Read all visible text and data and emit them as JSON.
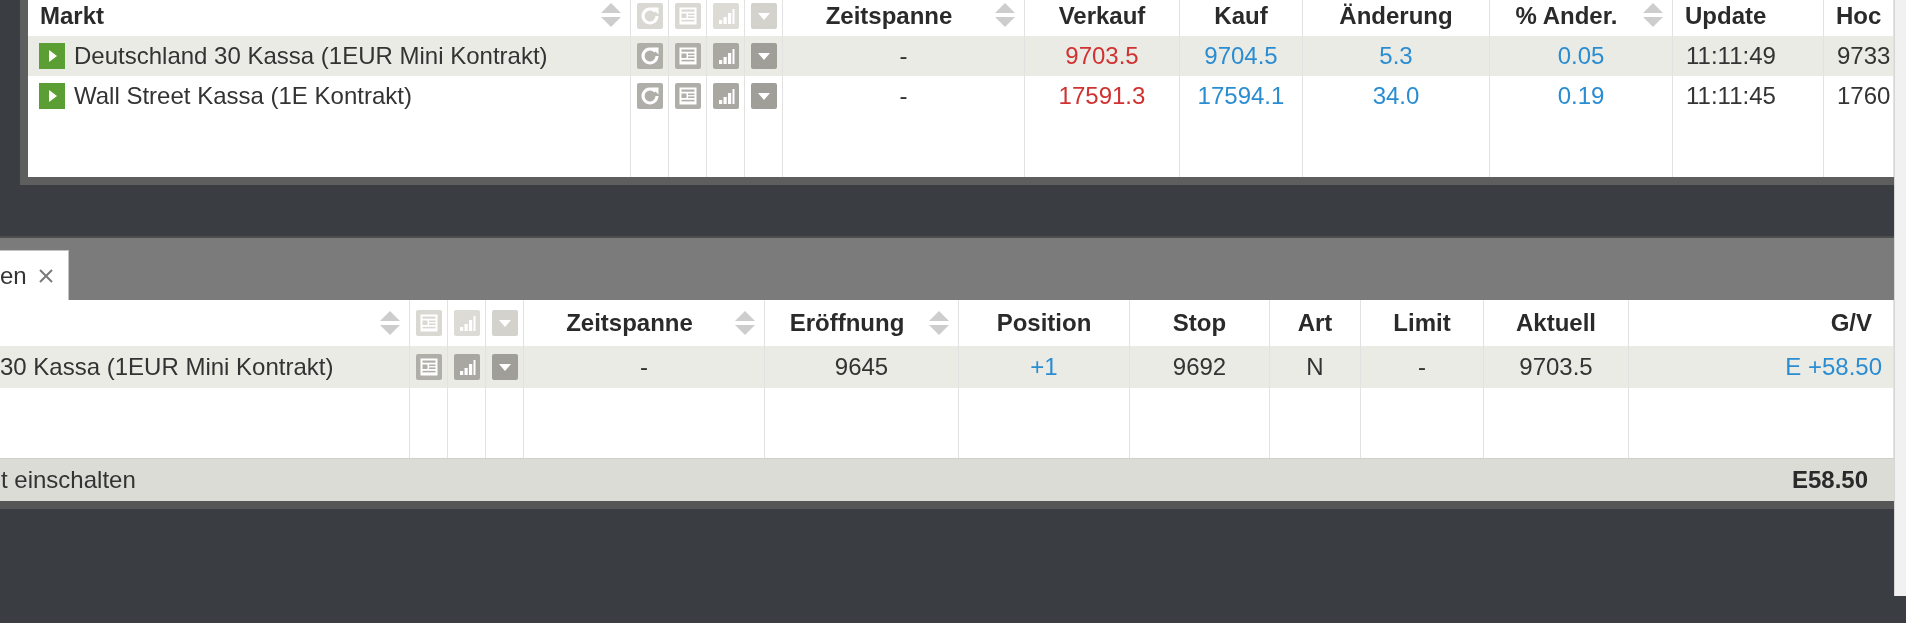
{
  "top_panel": {
    "columns": [
      {
        "label": "Markt",
        "kind": "market",
        "sortable": true
      },
      {
        "label": "Zeitspanne",
        "kind": "center",
        "sortable": true
      },
      {
        "label": "Verkauf",
        "kind": "sell",
        "sortable": false
      },
      {
        "label": "Kauf",
        "kind": "buy",
        "sortable": false
      },
      {
        "label": "Änderung",
        "kind": "rise",
        "sortable": false
      },
      {
        "label": "% Ander.",
        "kind": "rise",
        "sortable": true
      },
      {
        "label": "Update",
        "kind": "left",
        "sortable": false
      },
      {
        "label": "Hoc",
        "kind": "left",
        "sortable": false
      }
    ],
    "rows": [
      {
        "selected": true,
        "cells": [
          "Deutschland 30 Kassa (1EUR Mini Kontrakt)",
          "-",
          "9703.5",
          "9704.5",
          "5.3",
          "0.05",
          "11:11:49",
          "9733"
        ]
      },
      {
        "selected": false,
        "cells": [
          "Wall Street Kassa (1E Kontrakt)",
          "-",
          "17591.3",
          "17594.1",
          "34.0",
          "0.19",
          "11:11:45",
          "1760"
        ]
      }
    ]
  },
  "bottom_panel": {
    "tab": {
      "label": "en",
      "selected": true
    },
    "columns": [
      {
        "kind": "name",
        "sortable": true
      },
      {
        "label": "Zeitspanne",
        "kind": "center",
        "sortable": true
      },
      {
        "label": "Eröffnung",
        "kind": "center",
        "sortable": true
      },
      {
        "label": "Position",
        "kind": "rise",
        "sortable": false
      },
      {
        "label": "Stop",
        "kind": "center",
        "sortable": false
      },
      {
        "label": "Art",
        "kind": "center",
        "sortable": false
      },
      {
        "label": "Limit",
        "kind": "center",
        "sortable": false
      },
      {
        "label": "Aktuell",
        "kind": "center",
        "sortable": false
      },
      {
        "label": "G/V",
        "kind": "profit",
        "sortable": false
      }
    ],
    "rows": [
      {
        "selected": true,
        "cells": [
          "30 Kassa (1EUR Mini Kontrakt)",
          "-",
          "9645",
          "+1",
          "9692",
          "N",
          "-",
          "9703.5",
          "E +58.50"
        ]
      }
    ],
    "footer": {
      "text": "t einschalten",
      "total": "E58.50"
    }
  }
}
